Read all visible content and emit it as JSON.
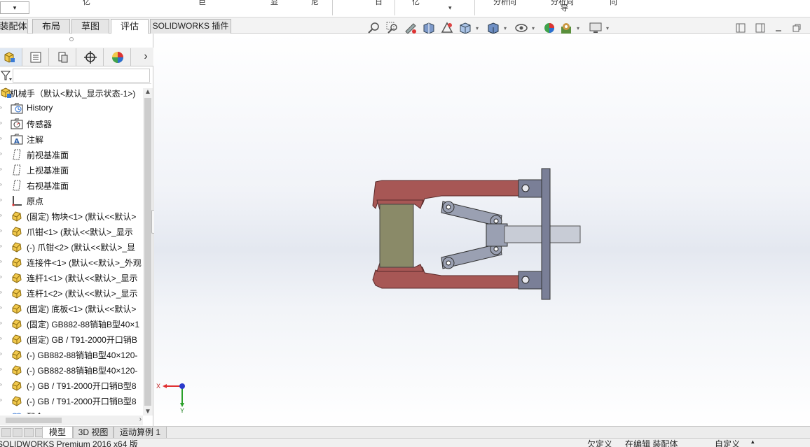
{
  "ribbon": {
    "dropdown_caret": "▾",
    "fragments": [
      "亿",
      "巨",
      "显",
      "尼",
      "日",
      "亿",
      "分析向",
      "分析向",
      "向",
      "导"
    ]
  },
  "tabs": [
    {
      "label": "装配体",
      "active": false
    },
    {
      "label": "布局",
      "active": false
    },
    {
      "label": "草图",
      "active": false
    },
    {
      "label": "评估",
      "active": true
    },
    {
      "label": "SOLIDWORKS 插件",
      "active": false
    }
  ],
  "view_toolbar": {
    "icons": [
      "zoom-to-fit-icon",
      "zoom-to-area-icon",
      "previous-view-icon",
      "section-view-icon",
      "dynamic-annotation-icon",
      "view-orientation-icon",
      "display-style-icon",
      "hide-show-items-icon",
      "edit-appearance-icon",
      "apply-scene-icon",
      "view-settings-icon"
    ]
  },
  "pane_tabs": [
    "featuremanager-icon",
    "propertymanager-icon",
    "configurationmanager-icon",
    "dimxpertmanager-icon",
    "displaymanager-icon"
  ],
  "tree": {
    "root": "机械手（默认<默认_显示状态-1>)",
    "items": [
      {
        "label": "History",
        "icon": "history-folder-icon"
      },
      {
        "label": "传感器",
        "icon": "sensor-icon"
      },
      {
        "label": "注解",
        "icon": "annotations-icon"
      },
      {
        "label": "前视基准面",
        "icon": "plane-icon"
      },
      {
        "label": "上视基准面",
        "icon": "plane-icon"
      },
      {
        "label": "右视基准面",
        "icon": "plane-icon"
      },
      {
        "label": "原点",
        "icon": "origin-icon"
      },
      {
        "label": "(固定) 物块<1> (默认<<默认>",
        "icon": "part-icon"
      },
      {
        "label": "爪钳<1> (默认<<默认>_显示",
        "icon": "part-icon"
      },
      {
        "label": "(-) 爪钳<2> (默认<<默认>_显",
        "icon": "part-icon"
      },
      {
        "label": "连接件<1> (默认<<默认>_外观",
        "icon": "part-icon"
      },
      {
        "label": "连杆1<1> (默认<<默认>_显示",
        "icon": "part-icon"
      },
      {
        "label": "连杆1<2> (默认<<默认>_显示",
        "icon": "part-icon"
      },
      {
        "label": "(固定) 底板<1> (默认<<默认>",
        "icon": "part-icon"
      },
      {
        "label": "(固定) GB882-88销轴B型40×1",
        "icon": "part-icon"
      },
      {
        "label": "(固定) GB / T91-2000开口销B",
        "icon": "part-icon"
      },
      {
        "label": "(-) GB882-88销轴B型40×120-",
        "icon": "part-icon"
      },
      {
        "label": "(-) GB882-88销轴B型40×120-",
        "icon": "part-icon"
      },
      {
        "label": "(-) GB / T91-2000开口销B型8",
        "icon": "part-icon"
      },
      {
        "label": "(-) GB / T91-2000开口销B型8",
        "icon": "part-icon"
      },
      {
        "label": "配合",
        "icon": "mates-icon"
      }
    ]
  },
  "triad": {
    "x_label": "X",
    "y_label": "Y"
  },
  "bottom_tabs": [
    {
      "label": "模型",
      "active": true
    },
    {
      "label": "3D 视图",
      "active": false
    },
    {
      "label": "运动算例 1",
      "active": false
    }
  ],
  "status": {
    "product": "SOLIDWORKS Premium 2016 x64 版",
    "definition": "欠定义",
    "editing": "在编辑 装配体",
    "units": "自定义",
    "units_caret": "▴"
  },
  "colors": {
    "jaw": "#a75755",
    "block": "#8a8a68",
    "link": "#9aa0b2",
    "plate": "#7a7f97",
    "rod": "#c8ccd6"
  }
}
